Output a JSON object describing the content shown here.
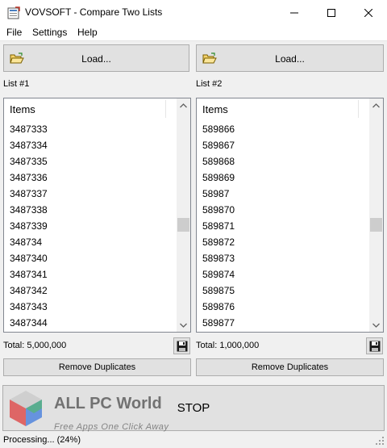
{
  "window": {
    "title": "VOVSOFT - Compare Two Lists"
  },
  "menu": [
    "File",
    "Settings",
    "Help"
  ],
  "left": {
    "load_label": "Load...",
    "list_label": "List #1",
    "header": "Items",
    "items": [
      "3487333",
      "3487334",
      "3487335",
      "3487336",
      "3487337",
      "3487338",
      "3487339",
      "348734",
      "3487340",
      "3487341",
      "3487342",
      "3487343",
      "3487344"
    ],
    "total": "Total: 5,000,000",
    "dup_label": "Remove Duplicates"
  },
  "right": {
    "load_label": "Load...",
    "list_label": "List #2",
    "header": "Items",
    "items": [
      "589866",
      "589867",
      "589868",
      "589869",
      "58987",
      "589870",
      "589871",
      "589872",
      "589873",
      "589874",
      "589875",
      "589876",
      "589877"
    ],
    "total": "Total: 1,000,000",
    "dup_label": "Remove Duplicates"
  },
  "stop_label": "STOP",
  "status": "Processing... (24%)",
  "watermark": {
    "title": "ALL PC World",
    "subtitle": "Free Apps One Click Away"
  },
  "icons": {
    "app": "app-icon",
    "folder": "folder-open-icon",
    "save": "floppy-disk-icon"
  }
}
